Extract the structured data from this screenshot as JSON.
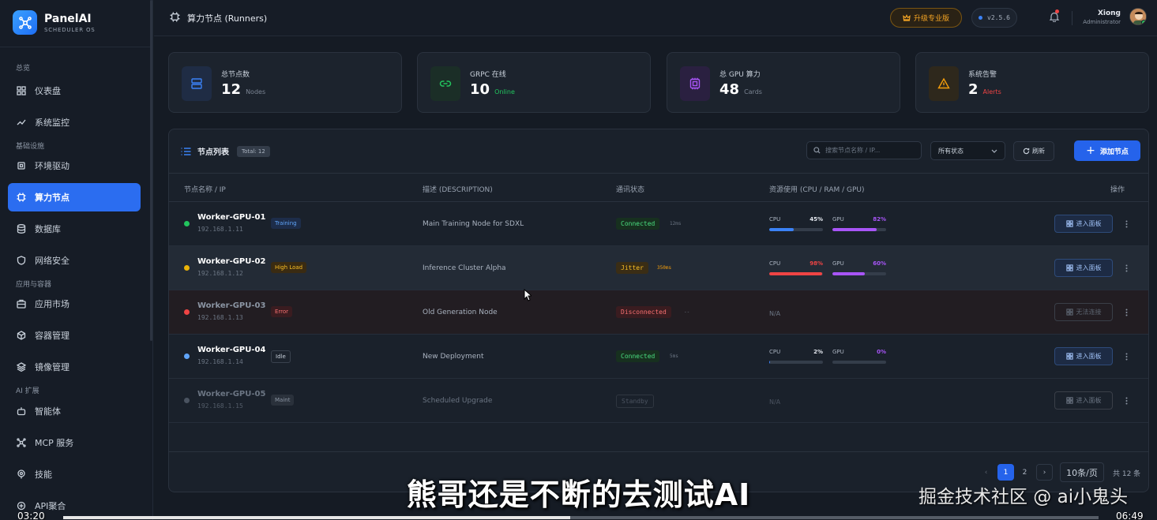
{
  "brand": {
    "name": "PanelAI",
    "subtitle": "SCHEDULER OS"
  },
  "sidebar": {
    "sections": [
      "总览",
      "基础设施",
      "应用与容器",
      "AI 扩展"
    ],
    "items": [
      {
        "label": "仪表盘",
        "icon": "dashboard-icon"
      },
      {
        "label": "系统监控",
        "icon": "chart-line-icon"
      },
      {
        "label": "环境驱动",
        "icon": "chip-icon"
      },
      {
        "label": "算力节点",
        "icon": "cpu-icon",
        "active": true
      },
      {
        "label": "数据库",
        "icon": "database-icon"
      },
      {
        "label": "网络安全",
        "icon": "shield-icon"
      },
      {
        "label": "应用市场",
        "icon": "store-icon"
      },
      {
        "label": "容器管理",
        "icon": "cube-icon"
      },
      {
        "label": "镜像管理",
        "icon": "layers-icon"
      },
      {
        "label": "智能体",
        "icon": "bot-icon"
      },
      {
        "label": "MCP 服务",
        "icon": "network-icon"
      },
      {
        "label": "技能",
        "icon": "target-icon"
      },
      {
        "label": "API聚合",
        "icon": "api-icon"
      }
    ]
  },
  "header": {
    "title": "算力节点 (Runners)",
    "upgrade_label": "升级专业版",
    "version": "v2.5.6",
    "user": {
      "name": "Xiong",
      "role": "Administrator"
    }
  },
  "stats": [
    {
      "label": "总节点数",
      "value": "12",
      "unit": "Nodes",
      "color": "#3b82f6"
    },
    {
      "label": "GRPC 在线",
      "value": "10",
      "unit": "Online",
      "color": "#22c55e"
    },
    {
      "label": "总 GPU 算力",
      "value": "48",
      "unit": "Cards",
      "color": "#a855f7"
    },
    {
      "label": "系统告警",
      "value": "2",
      "unit": "Alerts",
      "color": "#f59e0b"
    }
  ],
  "panel": {
    "title": "节点列表",
    "total": "Total: 12",
    "search_placeholder": "搜索节点名称 / IP...",
    "status_filter": "所有状态",
    "refresh_label": "刷新",
    "add_label": "添加节点",
    "columns": [
      "节点名称 / IP",
      "描述 (DESCRIPTION)",
      "通讯状态",
      "资源使用 (CPU / RAM / GPU)",
      "操作"
    ],
    "rows": [
      {
        "name": "Worker-GPU-01",
        "ip": "192.168.1.11",
        "tag": "Training",
        "desc": "Main Training Node for SDXL",
        "conn": "Connected",
        "latency": "12ms",
        "cpu_label": "CPU",
        "cpu": "45%",
        "cpu_val": 45,
        "gpu_label": "GPU",
        "gpu": "82%",
        "gpu_val": 82,
        "action": "进入面板"
      },
      {
        "name": "Worker-GPU-02",
        "ip": "192.168.1.12",
        "tag": "High Load",
        "desc": "Inference Cluster Alpha",
        "conn": "Jitter",
        "latency": "350ms",
        "cpu_label": "CPU",
        "cpu": "98%",
        "cpu_val": 98,
        "gpu_label": "GPU",
        "gpu": "60%",
        "gpu_val": 60,
        "action": "进入面板"
      },
      {
        "name": "Worker-GPU-03",
        "ip": "192.168.1.13",
        "tag": "Error",
        "desc": "Old Generation Node",
        "conn": "Disconnected",
        "latency": "--",
        "resource": "N/A",
        "action": "无法连接"
      },
      {
        "name": "Worker-GPU-04",
        "ip": "192.168.1.14",
        "tag": "Idle",
        "desc": "New Deployment",
        "conn": "Connected",
        "latency": "5ms",
        "cpu_label": "CPU",
        "cpu": "2%",
        "cpu_val": 2,
        "gpu_label": "GPU",
        "gpu": "0%",
        "gpu_val": 0,
        "action": "进入面板"
      },
      {
        "name": "Worker-GPU-05",
        "ip": "192.168.1.15",
        "tag": "Maint",
        "desc": "Scheduled Upgrade",
        "conn": "Standby",
        "latency": "",
        "resource": "N/A",
        "action": "进入面板"
      }
    ],
    "pagination": {
      "prev": "‹",
      "pages": [
        "1",
        "2"
      ],
      "next": "›",
      "page_size": "10条/页",
      "count": "共 12 条"
    }
  },
  "overlay": {
    "subtitle": "熊哥还是不断的去测试AI",
    "watermark": "掘金技术社区 @ ai小鬼头",
    "time_current": "03:20",
    "time_total": "06:49",
    "progress": 0.49
  },
  "colors": {
    "accent": "#2563eb",
    "success": "#22c55e",
    "warning": "#f5a524",
    "danger": "#ef4444",
    "gpu": "#a855f7"
  }
}
